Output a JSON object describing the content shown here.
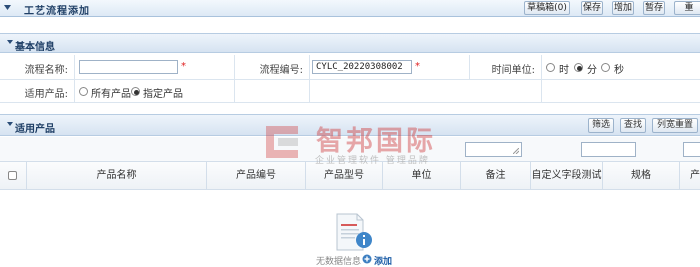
{
  "header": {
    "title": "工艺流程添加",
    "buttons": [
      "草稿箱(0)",
      "保存",
      "增加",
      "暂存",
      "重"
    ]
  },
  "basic": {
    "section_title": "基本信息",
    "flow_name_label": "流程名称:",
    "flow_name_value": "",
    "flow_code_label": "流程编号:",
    "flow_code_value": "CYLC_20220308002",
    "required_mark": "*",
    "time_unit_label": "时间单位:",
    "time_units": [
      {
        "label": "时",
        "selected": false
      },
      {
        "label": "分",
        "selected": true
      },
      {
        "label": "秒",
        "selected": false
      }
    ],
    "applies_label": "适用产品:",
    "applies_options": [
      {
        "label": "所有产品",
        "selected": false
      },
      {
        "label": "指定产品",
        "selected": true
      }
    ]
  },
  "products": {
    "section_title": "适用产品",
    "buttons": [
      "筛选",
      "查找",
      "列宽重置"
    ],
    "columns": [
      "产品名称",
      "产品编号",
      "产品型号",
      "单位",
      "备注",
      "自定义字段测试",
      "规格",
      "产"
    ],
    "empty_text": "无数据信息",
    "add_link": "添加"
  },
  "watermark": {
    "brand": "智邦国际",
    "tagline": "企业管理软件 管理品牌"
  },
  "colors": {
    "accent": "#1f3f66",
    "required": "#e02020",
    "watermark": "#cd3232"
  }
}
